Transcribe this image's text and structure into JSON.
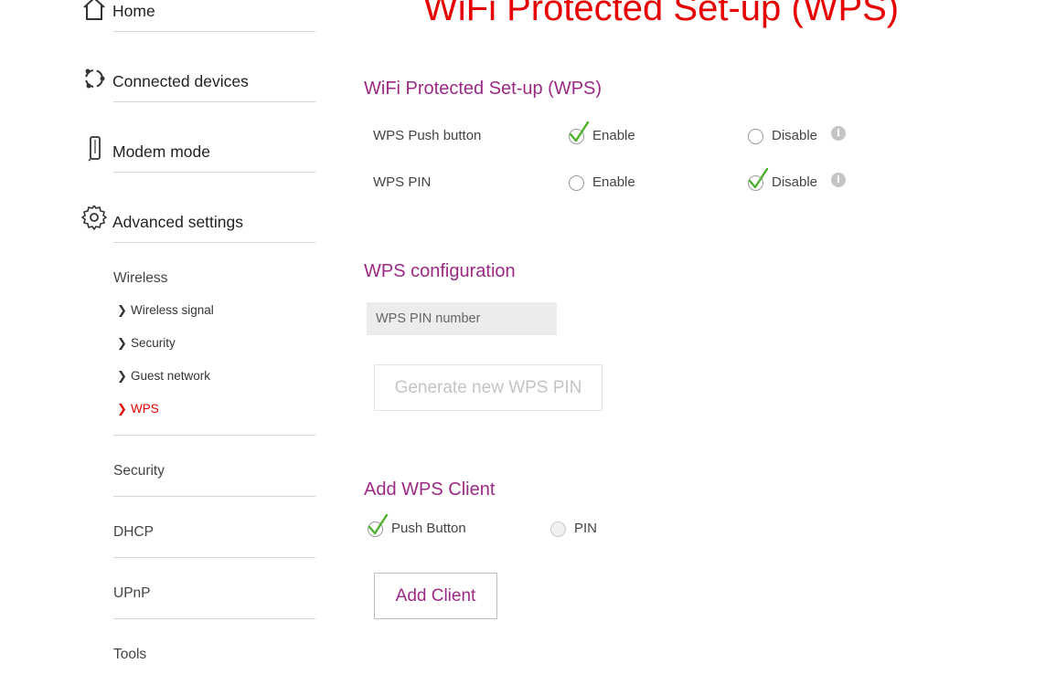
{
  "page": {
    "title": "WiFi Protected Set-up (WPS)"
  },
  "sidebar": {
    "nav": [
      {
        "label": "Home",
        "icon": "home-icon"
      },
      {
        "label": "Connected devices",
        "icon": "connected-devices-icon"
      },
      {
        "label": "Modem mode",
        "icon": "modem-icon"
      },
      {
        "label": "Advanced settings",
        "icon": "gear-icon"
      }
    ],
    "wireless": {
      "heading": "Wireless",
      "items": [
        {
          "label": "Wireless signal",
          "active": false
        },
        {
          "label": "Security",
          "active": false
        },
        {
          "label": "Guest network",
          "active": false
        },
        {
          "label": "WPS",
          "active": true
        }
      ]
    },
    "sections": [
      "Security",
      "DHCP",
      "UPnP",
      "Tools"
    ]
  },
  "wps": {
    "title": "WiFi Protected Set-up (WPS)",
    "push_button": {
      "label": "WPS Push button",
      "enable_label": "Enable",
      "disable_label": "Disable",
      "selected": "Enable"
    },
    "pin": {
      "label": "WPS PIN",
      "enable_label": "Enable",
      "disable_label": "Disable",
      "selected": "Disable"
    }
  },
  "config": {
    "title": "WPS configuration",
    "pin_placeholder": "WPS PIN number",
    "generate_label": "Generate new WPS PIN"
  },
  "client": {
    "title": "Add WPS Client",
    "push_button_label": "Push Button",
    "pin_label": "PIN",
    "selected": "Push Button",
    "add_label": "Add Client"
  },
  "colors": {
    "title_red": "#e60000",
    "section_purple": "#9c2a84",
    "check_green": "#4caf2e"
  }
}
